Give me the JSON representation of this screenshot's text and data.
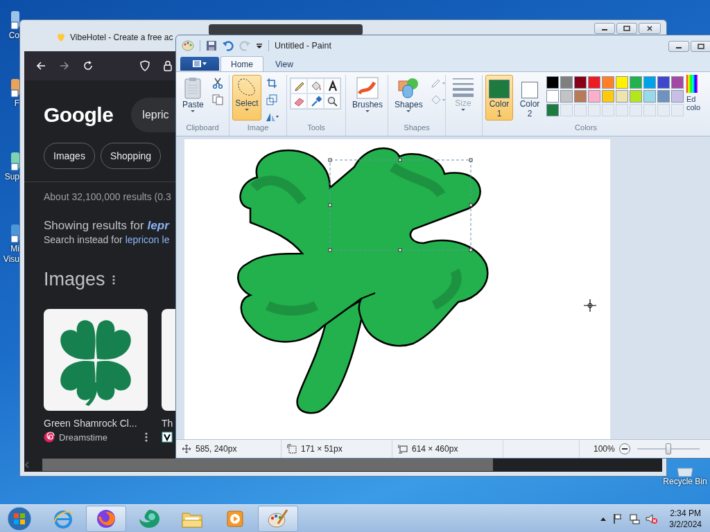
{
  "desktop": {
    "icons": [
      {
        "label": "Co"
      },
      {
        "label": "F"
      },
      {
        "label": "Sup"
      },
      {
        "label": "Mi Visu"
      }
    ],
    "recycle_bin": {
      "label": "Recycle Bin"
    }
  },
  "browser": {
    "tabs": [
      {
        "title": "VibeHotel - Create a free ac",
        "selected": true
      },
      {
        "selected": false
      }
    ],
    "logo": "Google",
    "search": {
      "value": "lepric"
    },
    "chips": [
      "Images",
      "Shopping"
    ],
    "result_stats": "About 32,100,000 results (0.3",
    "correction": {
      "label": "Showing results for",
      "link": "lepr"
    },
    "search_instead": {
      "label": "Search instead for",
      "link": "lepricon le"
    },
    "images_heading": "Images",
    "image_results": [
      {
        "title": "Green Shamrock Cl...",
        "source": "Dreamstime"
      },
      {
        "title": "Th"
      }
    ]
  },
  "paint": {
    "title": "Untitled - Paint",
    "tabs": [
      {
        "label": "Home",
        "selected": true
      },
      {
        "label": "View",
        "selected": false
      }
    ],
    "ribbon": {
      "clipboard": {
        "label": "Clipboard",
        "paste": "Paste"
      },
      "image": {
        "label": "Image",
        "select": {
          "label": "Select",
          "selected": true
        }
      },
      "tools": {
        "label": "Tools"
      },
      "brushes": {
        "label": "Brushes"
      },
      "shapes": {
        "label": "Shapes",
        "button": "Shapes"
      },
      "size": {
        "label": "Size",
        "disabled": true
      },
      "colors": {
        "label": "Colors",
        "color1": {
          "label": "Color",
          "number": "1",
          "color": "#1e7b3f",
          "selected": true
        },
        "color2": {
          "label": "Color",
          "number": "2",
          "color": "#ffffff",
          "selected": false
        },
        "palette": [
          [
            {
              "kind": "swatch",
              "color": "#000000"
            },
            {
              "kind": "swatch",
              "color": "#7f7f7f"
            },
            {
              "kind": "swatch",
              "color": "#880015"
            },
            {
              "kind": "swatch",
              "color": "#ed1c24"
            },
            {
              "kind": "swatch",
              "color": "#ff7f27"
            },
            {
              "kind": "swatch",
              "color": "#fff200"
            },
            {
              "kind": "swatch",
              "color": "#22b14c"
            },
            {
              "kind": "swatch",
              "color": "#00a2e8"
            },
            {
              "kind": "swatch",
              "color": "#3f48cc"
            },
            {
              "kind": "swatch",
              "color": "#a349a4"
            }
          ],
          [
            {
              "kind": "swatch",
              "color": "#ffffff"
            },
            {
              "kind": "swatch",
              "color": "#c3c3c3"
            },
            {
              "kind": "swatch",
              "color": "#b97a57"
            },
            {
              "kind": "swatch",
              "color": "#ffaec9"
            },
            {
              "kind": "swatch",
              "color": "#ffc90e"
            },
            {
              "kind": "swatch",
              "color": "#efe4b0"
            },
            {
              "kind": "swatch",
              "color": "#b5e61d"
            },
            {
              "kind": "swatch",
              "color": "#99d9ea"
            },
            {
              "kind": "swatch",
              "color": "#7092be"
            },
            {
              "kind": "swatch",
              "color": "#c8bfe7"
            }
          ],
          [
            {
              "kind": "swatch",
              "color": "#1e7b3f"
            },
            {
              "kind": "empty"
            },
            {
              "kind": "empty"
            },
            {
              "kind": "empty"
            },
            {
              "kind": "empty"
            },
            {
              "kind": "empty"
            },
            {
              "kind": "empty"
            },
            {
              "kind": "empty"
            },
            {
              "kind": "empty"
            },
            {
              "kind": "empty"
            }
          ]
        ],
        "edit_colors": "Ed colo"
      }
    },
    "status": {
      "cursor": "585, 240px",
      "selection": "171 × 51px",
      "canvas_size": "614 × 460px",
      "zoom": "100%",
      "zoom_slider": {
        "level": 0.5
      }
    }
  },
  "taskbar": {
    "apps": [
      {
        "kind": "e-browser",
        "active": false
      },
      {
        "kind": "fox-browser",
        "active": true
      },
      {
        "kind": "swirl-browser",
        "active": false
      },
      {
        "kind": "folder",
        "active": false
      },
      {
        "kind": "media",
        "active": false
      },
      {
        "kind": "paint",
        "active": true
      }
    ],
    "time": "2:34 PM",
    "date": "3/2/2024"
  }
}
